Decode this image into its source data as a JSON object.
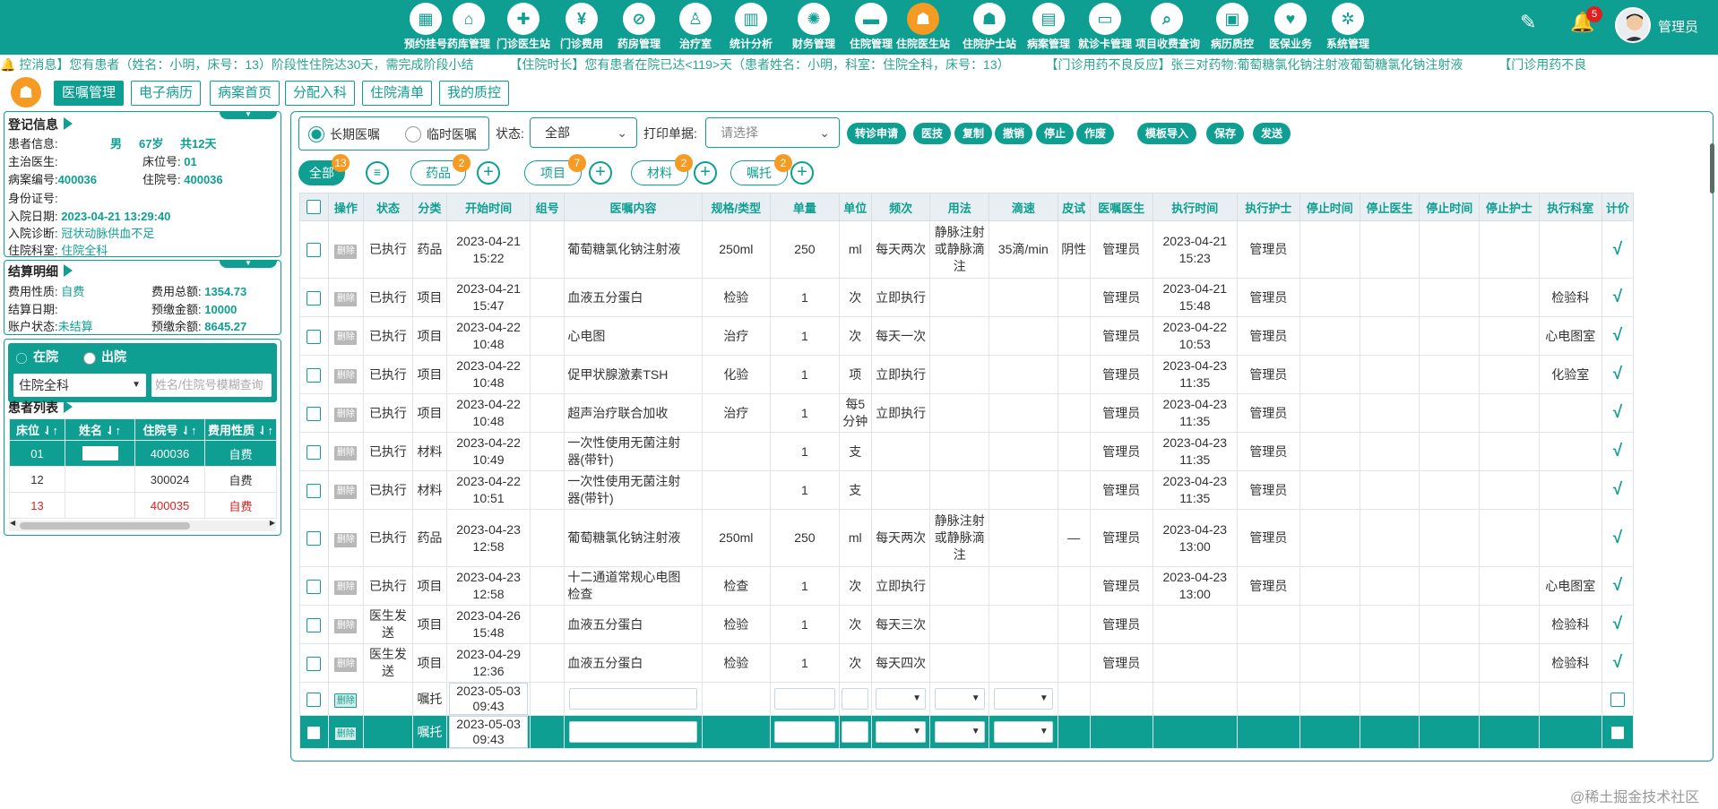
{
  "nav": [
    {
      "label": "预约挂号",
      "icon": "calendar-icon",
      "glyph": "▦"
    },
    {
      "label": "药库管理",
      "icon": "warehouse-icon",
      "glyph": "⌂"
    },
    {
      "label": "门诊医生站",
      "icon": "doctor-icon",
      "glyph": "✚"
    },
    {
      "label": "门诊费用",
      "icon": "yuan-icon",
      "glyph": "¥"
    },
    {
      "label": "药房管理",
      "icon": "pill-icon",
      "glyph": "⊘"
    },
    {
      "label": "治疗室",
      "icon": "nurse-icon",
      "glyph": "♙"
    },
    {
      "label": "统计分析",
      "icon": "bar-chart-icon",
      "glyph": "▥"
    },
    {
      "label": "财务管理",
      "icon": "gear-icon",
      "glyph": "✺"
    },
    {
      "label": "住院管理",
      "icon": "bed-icon",
      "glyph": "▬"
    },
    {
      "label": "住院医生站",
      "icon": "doctor-station-icon",
      "glyph": "☗"
    },
    {
      "label": "住院护士站",
      "icon": "nurse-station-icon",
      "glyph": "☗"
    },
    {
      "label": "病案管理",
      "icon": "record-icon",
      "glyph": "▤"
    },
    {
      "label": "就诊卡管理",
      "icon": "card-icon",
      "glyph": "▭"
    },
    {
      "label": "项目收费查询",
      "icon": "search-doc-icon",
      "glyph": "⌕"
    },
    {
      "label": "病历质控",
      "icon": "clipboard-icon",
      "glyph": "▣"
    },
    {
      "label": "医保业务",
      "icon": "insurance-icon",
      "glyph": "♥"
    },
    {
      "label": "系统管理",
      "icon": "settings-icon",
      "glyph": "✲"
    }
  ],
  "notif_count": "5",
  "user": "管理员",
  "ticker": [
    "🔔 控消息】您有患者（姓名：小明，床号：13）阶段性住院达30天，需完成阶段小结",
    "【住院时长】您有患者在院已达<119>天（患者姓名：小明，科室：住院全科，床号：13）",
    "【门诊用药不良反应】张三对药物:葡萄糖氯化钠注射液葡萄糖氯化钠注射液",
    "【门诊用药不良"
  ],
  "subtabs": [
    "医嘱管理",
    "电子病历",
    "病案首页",
    "分配入科",
    "住院清单",
    "我的质控"
  ],
  "reg": {
    "title": "登记信息",
    "patient_label": "患者信息:",
    "gender": "男",
    "age": "67岁",
    "days": "共12天",
    "doctor_label": "主治医生:",
    "bed_label": "床位号:",
    "bed": "01",
    "case_label": "病案编号:",
    "case": "400036",
    "inp_label": "住院号:",
    "inp": "400036",
    "id_label": "身份证号:",
    "admit_label": "入院日期:",
    "admit": "2023-04-21 13:29:40",
    "diag_label": "入院诊断:",
    "diag": "冠状动脉供血不足",
    "dept_label": "住院科室:",
    "dept": "住院全科"
  },
  "settle": {
    "title": "结算明细",
    "fee_type_label": "费用性质:",
    "fee_type": "自费",
    "total_label": "费用总额:",
    "total": "1354.73",
    "date_label": "结算日期:",
    "prepaid_label": "预缴金额:",
    "prepaid": "10000",
    "acct_label": "账户状态:",
    "acct": "未结算",
    "balance_label": "预缴余额:",
    "balance": "8645.27"
  },
  "plist": {
    "in": "在院",
    "out": "出院",
    "dept": "住院全科",
    "search_ph": "姓名/住院号模糊查询",
    "title": "患者列表",
    "headers": [
      "床位 ⇃↑",
      "姓名 ⇃↑",
      "住院号 ⇃↑",
      "费用性质 ⇃↑"
    ],
    "rows": [
      [
        "01",
        "",
        "400036",
        "自费"
      ],
      [
        "12",
        "",
        "300024",
        "自费"
      ],
      [
        "13",
        "",
        "400035",
        "自费"
      ]
    ]
  },
  "orders": {
    "long": "长期医嘱",
    "temp": "临时医嘱",
    "status_label": "状态:",
    "status": "全部",
    "print_label": "打印单据:",
    "print_ph": "请选择",
    "buttons": [
      "转诊申请",
      "医技",
      "复制",
      "撤销",
      "停止",
      "作废",
      "模板导入",
      "保存",
      "发送"
    ],
    "cats": [
      {
        "label": "全部",
        "count": "13"
      },
      {
        "label": "药品",
        "count": "2"
      },
      {
        "label": "项目",
        "count": "7"
      },
      {
        "label": "材料",
        "count": "2"
      },
      {
        "label": "嘱托",
        "count": "2"
      }
    ],
    "headers": [
      "",
      "操作",
      "状态",
      "分类",
      "开始时间",
      "组号",
      "医嘱内容",
      "规格/类型",
      "单量",
      "单位",
      "频次",
      "用法",
      "滴速",
      "皮试",
      "医嘱医生",
      "执行时间",
      "执行护士",
      "停止时间",
      "停止医生",
      "停止时间",
      "停止护士",
      "执行科室",
      "计价"
    ],
    "del": "删除",
    "rows": [
      [
        "已执行",
        "药品",
        "2023-04-21\n15:22",
        "",
        "葡萄糖氯化钠注射液",
        "250ml",
        "250",
        "ml",
        "每天两次",
        "静脉注射\n或静脉滴\n注",
        "35滴/min",
        "阴性",
        "管理员",
        "2023-04-21\n15:23",
        "管理员",
        "",
        "",
        "",
        "",
        "",
        "√"
      ],
      [
        "已执行",
        "项目",
        "2023-04-21\n15:47",
        "",
        "血液五分蛋白",
        "检验",
        "1",
        "次",
        "立即执行",
        "",
        "",
        "",
        "管理员",
        "2023-04-21\n15:48",
        "管理员",
        "",
        "",
        "",
        "",
        "检验科",
        "√"
      ],
      [
        "已执行",
        "项目",
        "2023-04-22\n10:48",
        "",
        "心电图",
        "治疗",
        "1",
        "次",
        "每天一次",
        "",
        "",
        "",
        "管理员",
        "2023-04-22\n10:53",
        "管理员",
        "",
        "",
        "",
        "",
        "心电图室",
        "√"
      ],
      [
        "已执行",
        "项目",
        "2023-04-22\n10:48",
        "",
        "促甲状腺激素TSH",
        "化验",
        "1",
        "项",
        "立即执行",
        "",
        "",
        "",
        "管理员",
        "2023-04-23\n11:35",
        "管理员",
        "",
        "",
        "",
        "",
        "化验室",
        "√"
      ],
      [
        "已执行",
        "项目",
        "2023-04-22\n10:48",
        "",
        "超声治疗联合加收",
        "治疗",
        "1",
        "每5\n分钟",
        "立即执行",
        "",
        "",
        "",
        "管理员",
        "2023-04-23\n11:35",
        "管理员",
        "",
        "",
        "",
        "",
        "",
        "√"
      ],
      [
        "已执行",
        "材料",
        "2023-04-22\n10:49",
        "",
        "一次性使用无菌注射\n器(带针)",
        "",
        "1",
        "支",
        "",
        "",
        "",
        "",
        "管理员",
        "2023-04-23\n11:35",
        "管理员",
        "",
        "",
        "",
        "",
        "",
        "√"
      ],
      [
        "已执行",
        "材料",
        "2023-04-22\n10:51",
        "",
        "一次性使用无菌注射\n器(带针)",
        "",
        "1",
        "支",
        "",
        "",
        "",
        "",
        "管理员",
        "2023-04-23\n11:35",
        "管理员",
        "",
        "",
        "",
        "",
        "",
        "√"
      ],
      [
        "已执行",
        "药品",
        "2023-04-23\n12:58",
        "",
        "葡萄糖氯化钠注射液",
        "250ml",
        "250",
        "ml",
        "每天两次",
        "静脉注射\n或静脉滴\n注",
        "",
        "—",
        "管理员",
        "2023-04-23\n13:00",
        "管理员",
        "",
        "",
        "",
        "",
        "",
        "√"
      ],
      [
        "已执行",
        "项目",
        "2023-04-23\n12:58",
        "",
        "十二通道常规心电图\n检查",
        "检查",
        "1",
        "次",
        "立即执行",
        "",
        "",
        "",
        "管理员",
        "2023-04-23\n13:00",
        "管理员",
        "",
        "",
        "",
        "",
        "心电图室",
        "√"
      ],
      [
        "医生发送",
        "项目",
        "2023-04-26\n15:48",
        "",
        "血液五分蛋白",
        "检验",
        "1",
        "次",
        "每天三次",
        "",
        "",
        "",
        "管理员",
        "",
        "",
        "",
        "",
        "",
        "",
        "检验科",
        "√"
      ],
      [
        "医生发送",
        "项目",
        "2023-04-29\n12:36",
        "",
        "血液五分蛋白",
        "检验",
        "1",
        "次",
        "每天四次",
        "",
        "",
        "",
        "管理员",
        "",
        "",
        "",
        "",
        "",
        "",
        "检验科",
        "√"
      ]
    ],
    "new_rows": [
      {
        "cat": "嘱托",
        "time": "2023-05-03\n09:43"
      },
      {
        "cat": "嘱托",
        "time": "2023-05-03\n09:43"
      }
    ]
  },
  "watermark": "@稀土掘金技术社区",
  "colors": {
    "primary": "#0f9f92",
    "accent": "#f59a23",
    "danger": "#e02020"
  }
}
